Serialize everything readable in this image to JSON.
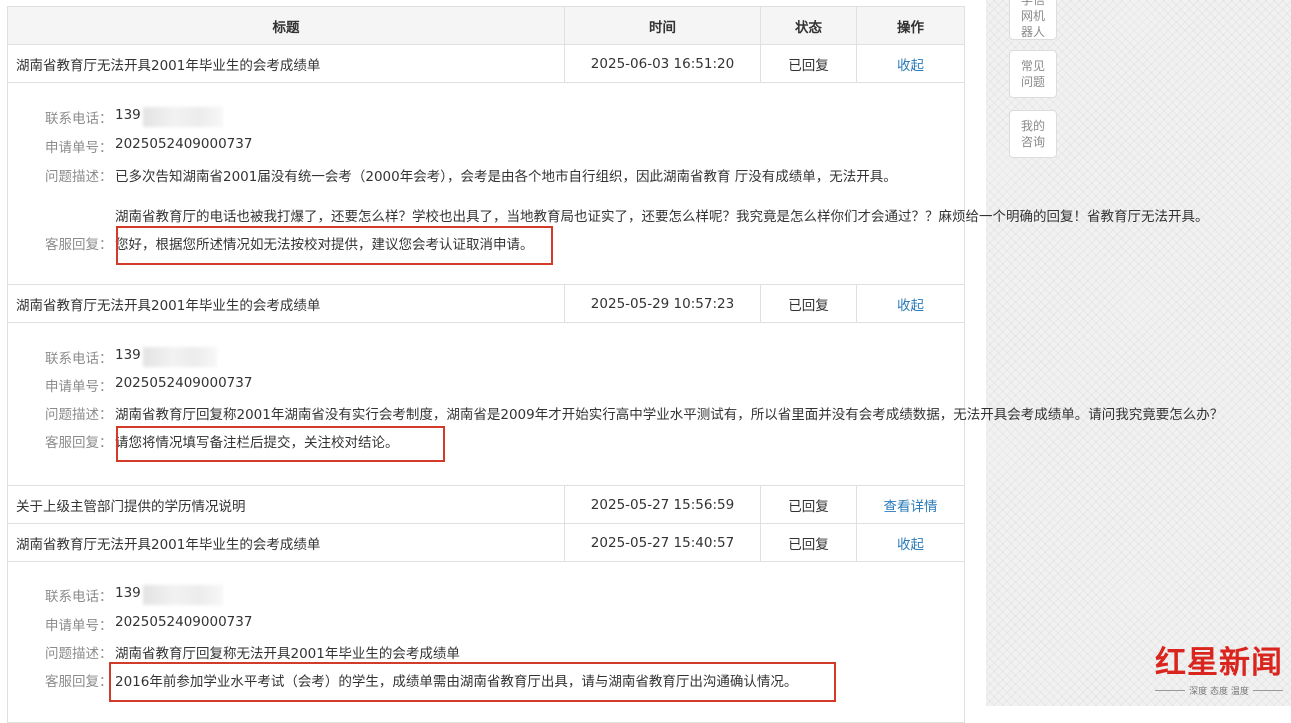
{
  "sidebar": {
    "buttons": [
      {
        "label": "学信网机器人"
      },
      {
        "label": "常见问题"
      },
      {
        "label": "我的咨询"
      }
    ]
  },
  "table": {
    "headers": {
      "title": "标题",
      "time": "时间",
      "status": "状态",
      "action": "操作"
    },
    "entries": [
      {
        "title": "湖南省教育厅无法开具2001年毕业生的会考成绩单",
        "time": "2025-06-03 16:51:20",
        "status": "已回复",
        "action": "收起",
        "detail": {
          "phone_label": "联系电话：",
          "phone": "139",
          "app_label": "申请单号：",
          "app_no": "2025052409000737",
          "desc_label": "问题描述：",
          "desc": "已多次告知湖南省2001届没有统一会考（2000年会考），会考是由各个地市自行组织，因此湖南省教育 厅没有成绩单，无法开具。",
          "desc2": "湖南省教育厅的电话也被我打爆了，还要怎么样？学校也出具了，当地教育局也证实了，还要怎么样呢？我究竟是怎么样你们才会通过？？麻烦给一个明确的回复！省教育厅无法开具。",
          "reply_label": "客服回复：",
          "reply": "您好，根据您所述情况如无法按校对提供，建议您会考认证取消申请。"
        }
      },
      {
        "title": "湖南省教育厅无法开具2001年毕业生的会考成绩单",
        "time": "2025-05-29 10:57:23",
        "status": "已回复",
        "action": "收起",
        "detail": {
          "phone_label": "联系电话：",
          "phone": "139",
          "app_label": "申请单号：",
          "app_no": "2025052409000737",
          "desc_label": "问题描述：",
          "desc": "湖南省教育厅回复称2001年湖南省没有实行会考制度，湖南省是2009年才开始实行高中学业水平测试有，所以省里面并没有会考成绩数据，无法开具会考成绩单。请问我究竟要怎么办？",
          "reply_label": "客服回复：",
          "reply": "请您将情况填写备注栏后提交，关注校对结论。"
        }
      },
      {
        "title": "关于上级主管部门提供的学历情况说明",
        "time": "2025-05-27 15:56:59",
        "status": "已回复",
        "action": "查看详情"
      },
      {
        "title": "湖南省教育厅无法开具2001年毕业生的会考成绩单",
        "time": "2025-05-27 15:40:57",
        "status": "已回复",
        "action": "收起",
        "detail": {
          "phone_label": "联系电话：",
          "phone": "139",
          "app_label": "申请单号：",
          "app_no": "2025052409000737",
          "desc_label": "问题描述：",
          "desc": "湖南省教育厅回复称无法开具2001年毕业生的会考成绩单",
          "reply_label": "客服回复：",
          "reply": "2016年前参加学业水平考试（会考）的学生，成绩单需由湖南省教育厅出具，请与湖南省教育厅出沟通确认情况。"
        }
      }
    ]
  },
  "watermark": {
    "name_a": "红星",
    "name_b": "新闻",
    "tagline": "深度 态度 温度",
    "color": "#d9251d"
  },
  "colors": {
    "link": "#2b7bb9",
    "highlight_box": "#d23a2a"
  }
}
